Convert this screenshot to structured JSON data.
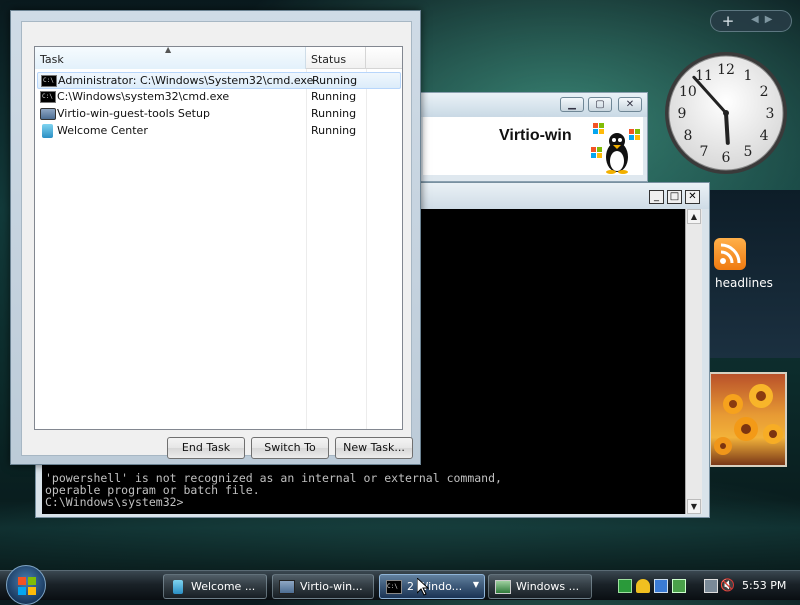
{
  "task_manager": {
    "columns": {
      "task": "Task",
      "status": "Status"
    },
    "tasks": [
      {
        "name": "Administrator: C:\\Windows\\System32\\cmd.exe",
        "status": "Running",
        "icon": "cmd-icon"
      },
      {
        "name": "C:\\Windows\\system32\\cmd.exe",
        "status": "Running",
        "icon": "cmd-icon"
      },
      {
        "name": "Virtio-win-guest-tools Setup",
        "status": "Running",
        "icon": "setup-icon"
      },
      {
        "name": "Welcome Center",
        "status": "Running",
        "icon": "welcome-center-icon"
      }
    ],
    "buttons": {
      "end_task": "End Task",
      "switch_to": "Switch To",
      "new_task": "New Task..."
    }
  },
  "virtio_window": {
    "banner_title": "Virtio-win"
  },
  "cmd_window": {
    "lines": [
      "'powershell' is not recognized as an internal or external command,",
      "operable program or batch file.",
      "",
      "C:\\Windows\\system32>"
    ]
  },
  "sidebar": {
    "feed_label": "headlines",
    "clock": {
      "hour": 5,
      "minute": 53
    }
  },
  "taskbar": {
    "items": [
      {
        "label": "Welcome ...",
        "icon": "welcome-center-icon"
      },
      {
        "label": "Virtio-win...",
        "icon": "setup-icon"
      },
      {
        "label": "2 Windo...",
        "icon": "cmd-icon"
      },
      {
        "label": "Windows ...",
        "icon": "task-manager-icon"
      }
    ],
    "clock": "5:53 PM"
  },
  "colors": {
    "cmd_text": "#c0c0c0",
    "selection": "#dcecfa",
    "taskbar": "#1a2228"
  }
}
